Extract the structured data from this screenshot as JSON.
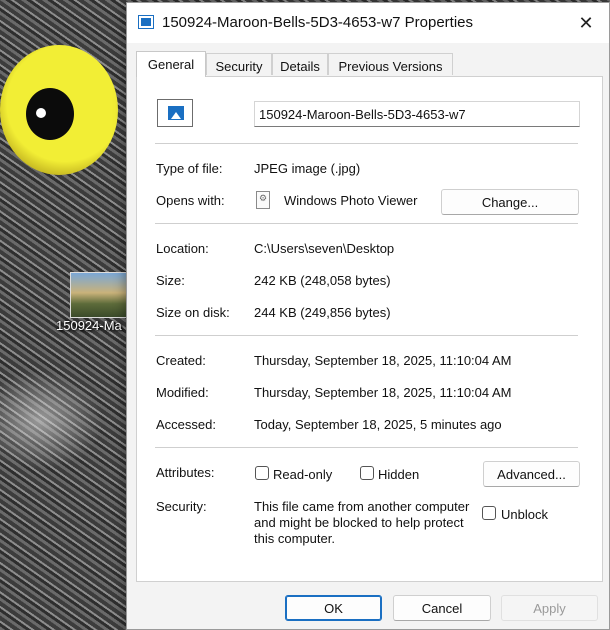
{
  "desktop": {
    "icon_label": "150924-Ma"
  },
  "window": {
    "title": "150924-Maroon-Bells-5D3-4653-w7 Properties",
    "close_glyph": "✕"
  },
  "tabs": [
    {
      "label": "General",
      "active": true
    },
    {
      "label": "Security",
      "active": false
    },
    {
      "label": "Details",
      "active": false
    },
    {
      "label": "Previous Versions",
      "active": false
    }
  ],
  "general": {
    "file_name": "150924-Maroon-Bells-5D3-4653-w7",
    "type_label": "Type of file:",
    "type_value": "JPEG image (.jpg)",
    "opens_label": "Opens with:",
    "opens_value": "Windows Photo Viewer",
    "change_button": "Change...",
    "location_label": "Location:",
    "location_value": "C:\\Users\\seven\\Desktop",
    "size_label": "Size:",
    "size_value": "242 KB (248,058 bytes)",
    "size_on_disk_label": "Size on disk:",
    "size_on_disk_value": "244 KB (249,856 bytes)",
    "created_label": "Created:",
    "created_value": "Thursday, September 18, 2025, 11:10:04 AM",
    "modified_label": "Modified:",
    "modified_value": "Thursday, September 18, 2025, 11:10:04 AM",
    "accessed_label": "Accessed:",
    "accessed_value": "Today, September 18, 2025, 5 minutes ago",
    "attributes_label": "Attributes:",
    "readonly_label": "Read-only",
    "hidden_label": "Hidden",
    "advanced_button": "Advanced...",
    "security_label": "Security:",
    "security_text": "This file came from another computer and might be blocked to help protect this computer.",
    "unblock_label": "Unblock"
  },
  "footer": {
    "ok": "OK",
    "cancel": "Cancel",
    "apply": "Apply"
  },
  "colors": {
    "accent": "#1a6fc2"
  }
}
